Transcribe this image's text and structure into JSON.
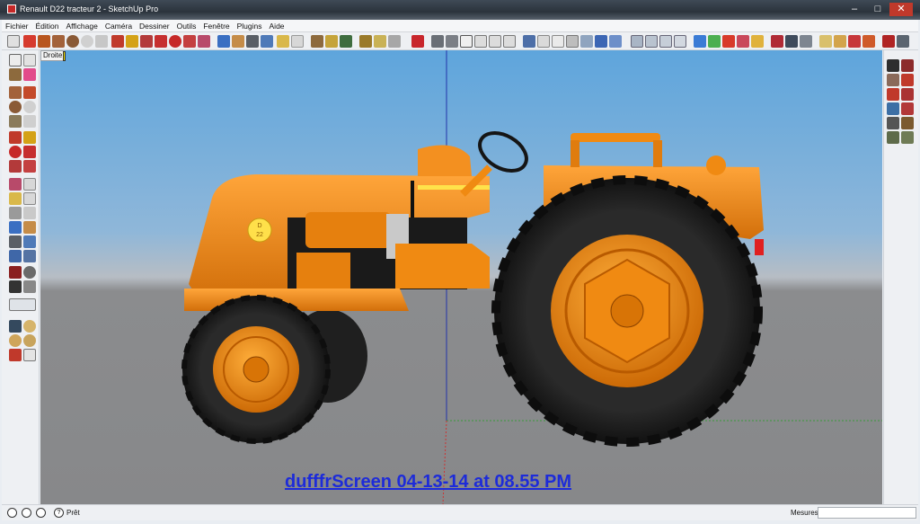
{
  "window": {
    "title": "Renault D22 tracteur 2 - SketchUp Pro"
  },
  "menu": [
    "Fichier",
    "Édition",
    "Affichage",
    "Caméra",
    "Dessiner",
    "Outils",
    "Fenêtre",
    "Plugins",
    "Aide"
  ],
  "scene": {
    "label": "Droite"
  },
  "watermark": "dufffrScreen 04-13-14 at 08.55 PM",
  "tractor_decal": {
    "line1": "D",
    "line2": "22"
  },
  "status": {
    "text": "Prêt",
    "measures_label": "Mesures",
    "help_icon": "?"
  },
  "colors": {
    "orange": "#f08a12",
    "tire": "#1c1c1c",
    "sky": "#5ea5dc",
    "ground": "#88898b"
  }
}
